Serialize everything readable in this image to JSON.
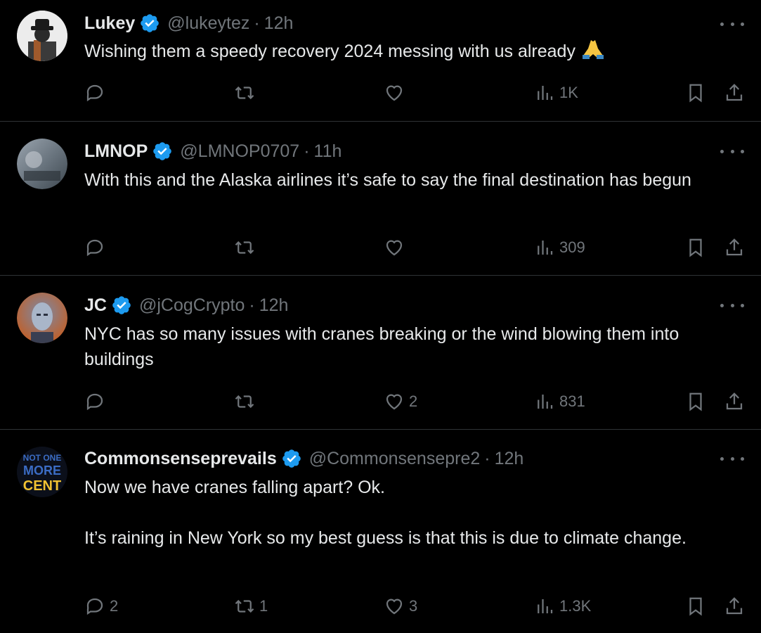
{
  "theme": {
    "background": "#000000",
    "text": "#e7e9ea",
    "muted": "#71767b",
    "divider": "#2f3336",
    "verified": "#1d9bf0"
  },
  "tweets": [
    {
      "name": "Lukey",
      "handle": "@lukeytez",
      "separator": "·",
      "time": "12h",
      "verified": true,
      "text": [
        "Wishing them a speedy recovery 2024 messing with us already"
      ],
      "emoji": "folded-hands",
      "counts": {
        "replies": "",
        "reposts": "",
        "likes": "",
        "views": "1K"
      }
    },
    {
      "name": "LMNOP",
      "handle": "@LMNOP0707",
      "separator": "·",
      "time": "11h",
      "verified": true,
      "text": [
        "With this and the Alaska airlines it’s safe to say the final destination has begun"
      ],
      "counts": {
        "replies": "",
        "reposts": "",
        "likes": "",
        "views": "309"
      }
    },
    {
      "name": "JC",
      "handle": "@jCogCrypto",
      "separator": "·",
      "time": "12h",
      "verified": true,
      "text": [
        "NYC has so many issues with cranes breaking or the wind blowing them into buildings"
      ],
      "counts": {
        "replies": "",
        "reposts": "",
        "likes": "2",
        "views": "831"
      }
    },
    {
      "name": "Commonsenseprevails",
      "handle": "@Commonsensepre2",
      "separator": "·",
      "time": "12h",
      "verified": true,
      "avatar_text": [
        "NOT ONE",
        "MORE",
        "CENT"
      ],
      "text": [
        "Now we have cranes falling apart? Ok.",
        "It’s raining in New York so my best guess is that this is due to climate change."
      ],
      "counts": {
        "replies": "2",
        "reposts": "1",
        "likes": "3",
        "views": "1.3K"
      }
    }
  ],
  "icons": {
    "reply": "speech-bubble-icon",
    "repost": "repost-arrows-icon",
    "like": "heart-icon",
    "views": "bar-chart-icon",
    "bookmark": "bookmark-icon",
    "share": "share-upload-icon",
    "more": "more-dots-icon",
    "verified": "verified-badge-icon"
  }
}
